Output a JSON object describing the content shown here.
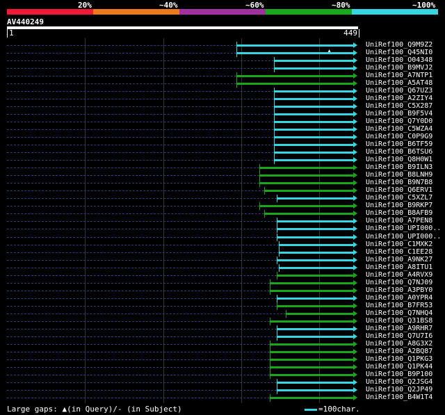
{
  "colors": {
    "band_red": "#f01a38",
    "band_orange": "#ee7a1c",
    "band_purple": "#a2309f",
    "band_green": "#1ba71c",
    "band_cyan": "#35d6e0",
    "hit_green": "#1aa61a",
    "hit_cyan": "#35d6e0"
  },
  "identity_bands": [
    {
      "label": "20%",
      "color": "band_red"
    },
    {
      "label": "~40%",
      "color": "band_orange"
    },
    {
      "label": "~60%",
      "color": "band_purple"
    },
    {
      "label": "~80%",
      "color": "band_green"
    },
    {
      "label": "~100%",
      "color": "band_cyan"
    }
  ],
  "query": {
    "name": "AV440249",
    "length": 449,
    "start_label": "1",
    "end_label": "449"
  },
  "gap_icon": "triangle-up-icon",
  "hits": [
    {
      "name": "UniRef100_Q9M9Z2",
      "start": 298,
      "end": 449,
      "color": "hit_cyan",
      "gap_at": 418
    },
    {
      "name": "UniRef100_Q45NI0",
      "start": 298,
      "end": 449,
      "color": "hit_cyan"
    },
    {
      "name": "UniRef100_O04348",
      "start": 346,
      "end": 449,
      "color": "hit_cyan"
    },
    {
      "name": "UniRef100_B9MVJ2",
      "start": 346,
      "end": 449,
      "color": "hit_cyan"
    },
    {
      "name": "UniRef100_A7NTP1",
      "start": 298,
      "end": 449,
      "color": "hit_green"
    },
    {
      "name": "UniRef100_A5AT48",
      "start": 298,
      "end": 449,
      "color": "hit_green"
    },
    {
      "name": "UniRef100_Q67UZ3",
      "start": 346,
      "end": 449,
      "color": "hit_cyan"
    },
    {
      "name": "UniRef100_A2ZIY4",
      "start": 346,
      "end": 449,
      "color": "hit_cyan"
    },
    {
      "name": "UniRef100_C5X287",
      "start": 346,
      "end": 449,
      "color": "hit_cyan"
    },
    {
      "name": "UniRef100_B9F5V4",
      "start": 346,
      "end": 449,
      "color": "hit_cyan"
    },
    {
      "name": "UniRef100_Q7Y0D0",
      "start": 346,
      "end": 449,
      "color": "hit_cyan"
    },
    {
      "name": "UniRef100_C5WZA4",
      "start": 346,
      "end": 449,
      "color": "hit_cyan"
    },
    {
      "name": "UniRef100_C0P9G9",
      "start": 346,
      "end": 449,
      "color": "hit_cyan"
    },
    {
      "name": "UniRef100_B6TF59",
      "start": 346,
      "end": 449,
      "color": "hit_cyan"
    },
    {
      "name": "UniRef100_B6TSU6",
      "start": 346,
      "end": 449,
      "color": "hit_cyan"
    },
    {
      "name": "UniRef100_Q8H0W1",
      "start": 346,
      "end": 449,
      "color": "hit_cyan"
    },
    {
      "name": "UniRef100_B9ILN3",
      "start": 328,
      "end": 449,
      "color": "hit_green"
    },
    {
      "name": "UniRef100_B8LNH9",
      "start": 328,
      "end": 449,
      "color": "hit_green"
    },
    {
      "name": "UniRef100_B9N7B8",
      "start": 328,
      "end": 449,
      "color": "hit_green"
    },
    {
      "name": "UniRef100_Q6ERV1",
      "start": 334,
      "end": 449,
      "color": "hit_green"
    },
    {
      "name": "UniRef100_C5XZL7",
      "start": 350,
      "end": 449,
      "color": "hit_cyan"
    },
    {
      "name": "UniRef100_B9RKP7",
      "start": 328,
      "end": 449,
      "color": "hit_green"
    },
    {
      "name": "UniRef100_B8AFB9",
      "start": 334,
      "end": 449,
      "color": "hit_green"
    },
    {
      "name": "UniRef100_A7PEN8",
      "start": 350,
      "end": 449,
      "color": "hit_cyan"
    },
    {
      "name": "UniRef100_UPI000..",
      "start": 350,
      "end": 449,
      "color": "hit_cyan"
    },
    {
      "name": "UniRef100_UPI000..",
      "start": 350,
      "end": 449,
      "color": "hit_cyan"
    },
    {
      "name": "UniRef100_C1MXK2",
      "start": 353,
      "end": 449,
      "color": "hit_cyan"
    },
    {
      "name": "UniRef100_C1EE28",
      "start": 353,
      "end": 449,
      "color": "hit_cyan"
    },
    {
      "name": "UniRef100_A9NK27",
      "start": 350,
      "end": 449,
      "color": "hit_cyan"
    },
    {
      "name": "UniRef100_A8ITU1",
      "start": 353,
      "end": 449,
      "color": "hit_cyan"
    },
    {
      "name": "UniRef100_A4RVX9",
      "start": 350,
      "end": 449,
      "color": "hit_green"
    },
    {
      "name": "UniRef100_Q7NJ09",
      "start": 341,
      "end": 449,
      "color": "hit_green"
    },
    {
      "name": "UniRef100_A3PBY0",
      "start": 341,
      "end": 449,
      "color": "hit_green"
    },
    {
      "name": "UniRef100_A0YPR4",
      "start": 350,
      "end": 449,
      "color": "hit_cyan"
    },
    {
      "name": "UniRef100_B7FR53",
      "start": 350,
      "end": 449,
      "color": "hit_green"
    },
    {
      "name": "UniRef100_Q7NHQ4",
      "start": 362,
      "end": 449,
      "color": "hit_green"
    },
    {
      "name": "UniRef100_Q31BS8",
      "start": 341,
      "end": 449,
      "color": "hit_green"
    },
    {
      "name": "UniRef100_A9RHR7",
      "start": 350,
      "end": 449,
      "color": "hit_cyan"
    },
    {
      "name": "UniRef100_Q7U7I6",
      "start": 350,
      "end": 449,
      "color": "hit_cyan"
    },
    {
      "name": "UniRef100_A8G3X2",
      "start": 341,
      "end": 449,
      "color": "hit_green"
    },
    {
      "name": "UniRef100_A2BQ87",
      "start": 341,
      "end": 449,
      "color": "hit_green"
    },
    {
      "name": "UniRef100_Q1PKG3",
      "start": 341,
      "end": 449,
      "color": "hit_green"
    },
    {
      "name": "UniRef100_Q1PK44",
      "start": 341,
      "end": 449,
      "color": "hit_green"
    },
    {
      "name": "UniRef100_B9P100",
      "start": 341,
      "end": 449,
      "color": "hit_green"
    },
    {
      "name": "UniRef100_Q2JSG4",
      "start": 350,
      "end": 449,
      "color": "hit_cyan"
    },
    {
      "name": "UniRef100_Q2JP49",
      "start": 350,
      "end": 449,
      "color": "hit_cyan"
    },
    {
      "name": "UniRef100_B4W1T4",
      "start": 341,
      "end": 449,
      "color": "hit_green"
    }
  ],
  "legend": {
    "large_gaps": "Large gaps: ▲(in Query)/- (in Subject)",
    "scale_label": "=100char."
  }
}
